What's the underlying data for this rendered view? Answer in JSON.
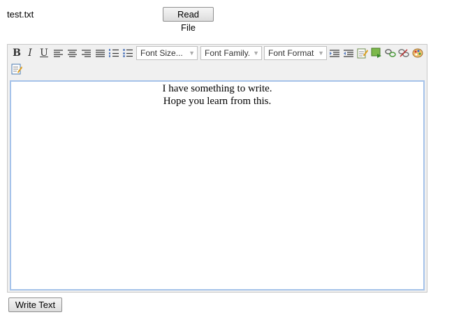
{
  "file": {
    "name": "test.txt"
  },
  "buttons": {
    "read_file": "Read File",
    "write_text": "Write Text"
  },
  "toolbar": {
    "bold": "B",
    "italic": "I",
    "underline": "U",
    "font_size_placeholder": "Font Size...",
    "font_family_placeholder": "Font Family.",
    "font_format_placeholder": "Font Format"
  },
  "editor": {
    "lines": [
      "I have something to write.",
      "Hope you learn from this."
    ],
    "border_color": "#a6c3ea"
  }
}
